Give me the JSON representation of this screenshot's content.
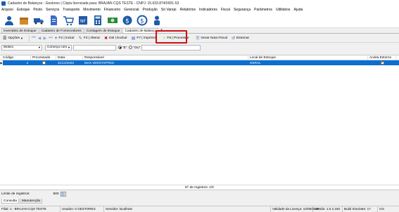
{
  "window": {
    "title": "Cadastro de Balanços - Gestores | Cópia licenciada para: BRAJAN CQS TESTE - CNPJ: 15.633.874/0001-53"
  },
  "menu": [
    "Arquivo",
    "Estoque",
    "Posto",
    "Serviços",
    "Transporte",
    "Movimento",
    "Financeiro",
    "Gerencial",
    "Produção",
    "Só Varejo",
    "Relatórios",
    "Indicadores",
    "Fiscal",
    "Segurança",
    "Parâmetros",
    "Utilitários",
    "Ajuda"
  ],
  "icon_bar": [
    {
      "icon": "user-icon",
      "color": "#1f5aa6"
    },
    {
      "icon": "box-icon",
      "color": "#d48a2a"
    },
    {
      "icon": "truck-icon",
      "color": "#1f5aa6"
    },
    {
      "icon": "document-icon",
      "color": "#3a6cc8"
    },
    {
      "icon": "cart-icon",
      "color": "#1f5aa6"
    },
    {
      "icon": "nfe-icon",
      "color": "#1f5aa6"
    },
    {
      "icon": "calculator-icon",
      "color": "#1f5aa6"
    },
    {
      "icon": "money-icon",
      "color": "#2a8a3a"
    },
    {
      "icon": "dollar-icon",
      "color": "#1f5aa6"
    },
    {
      "icon": "coin-icon",
      "color": "#1f5aa6"
    },
    {
      "icon": "person-icon",
      "color": "#1f5aa6"
    }
  ],
  "tabs": {
    "items": [
      "Inventário de Estoque",
      "Cadastro de Fornecedores",
      "Contagem de Estoque",
      "Cadastro de Balanço"
    ],
    "close": "x"
  },
  "toolbar": {
    "options": "Opções",
    "add": "F2 | Incluir",
    "edit": "F3 | Alterar",
    "delete": "Del | Excluir",
    "print": "F7 | Imprimir",
    "process": "F8 | Processar",
    "generate": "Gerar Nota Fiscal",
    "reverse": "Estornar"
  },
  "filter": {
    "field": "Motivo",
    "operator": "Começa com",
    "value": "",
    "radio_and": "\"E\"",
    "radio_or": "\"OU\""
  },
  "grid": {
    "columns": [
      "Código",
      "Processado",
      "Data",
      "Responsável",
      "Local de Estoque",
      "Aceita Estorno"
    ],
    "rows": [
      {
        "codigo": "4",
        "processado": false,
        "data": "21/12/2023",
        "responsavel": "MAX VERSTAPPEN",
        "local": "GERAL",
        "aceita_estorno": true
      }
    ],
    "footer": "Nº de registros: 1/0"
  },
  "limit": {
    "label": "Limite de registros:",
    "value": "500"
  },
  "bottom_tabs": [
    "Consulta",
    "Manutenção"
  ],
  "status": {
    "branch": "Filial: 1 - BRAJAN CQS TESTE",
    "user": "Usuário: 0 GESTORES",
    "server": "Servidor: localhost",
    "license": "Validade da Licença: 10/08/2025",
    "version": "Versão: 1.0.2.150",
    "build": "Build SincDate: 17",
    "caps": "CN"
  }
}
